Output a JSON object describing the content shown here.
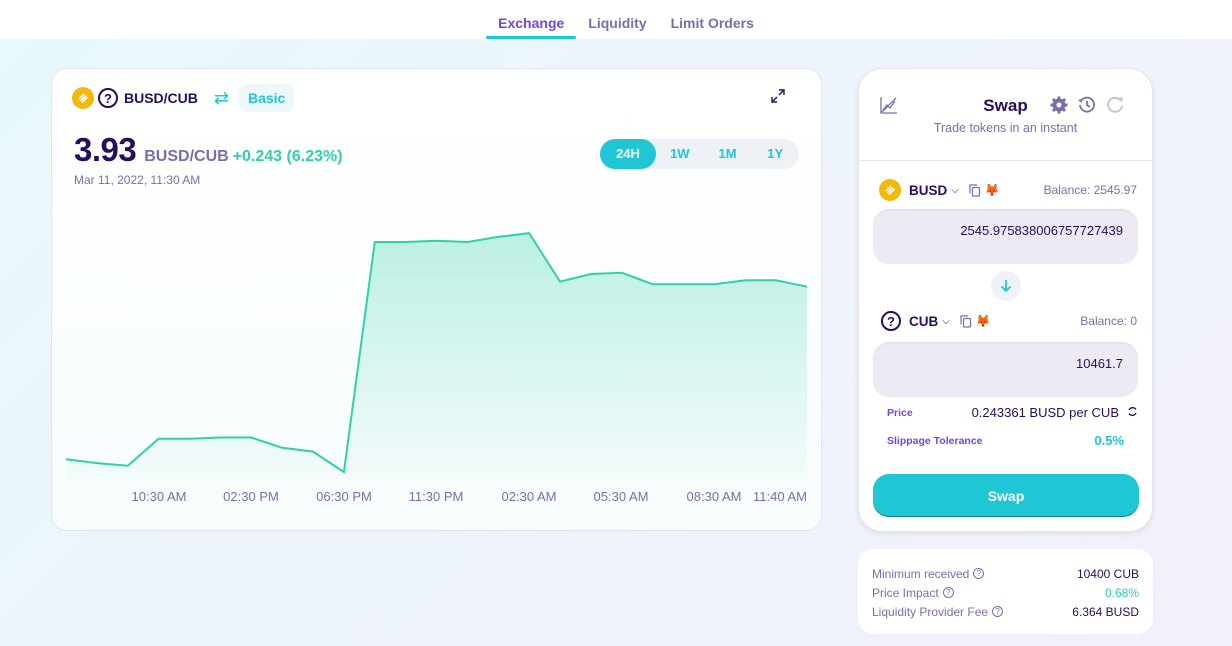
{
  "nav": {
    "tabs": [
      {
        "label": "Exchange",
        "active": true
      },
      {
        "label": "Liquidity",
        "active": false
      },
      {
        "label": "Limit Orders",
        "active": false
      }
    ]
  },
  "chart_card": {
    "pair_label": "BUSD/CUB",
    "mode_button": "Basic",
    "price": "3.93",
    "price_pair": "BUSD/CUB",
    "price_change": "+0.243 (6.23%)",
    "date": "Mar 11, 2022, 11:30 AM",
    "ranges": [
      {
        "label": "24H",
        "active": true
      },
      {
        "label": "1W",
        "active": false
      },
      {
        "label": "1M",
        "active": false
      },
      {
        "label": "1Y",
        "active": false
      }
    ],
    "icons": {
      "pair_swap": "swap-arrows-icon",
      "expand": "expand-icon"
    }
  },
  "chart_data": {
    "type": "area",
    "x_tick_labels": [
      "10:30 AM",
      "02:30 PM",
      "06:30 PM",
      "11:30 PM",
      "02:30 AM",
      "05:30 AM",
      "08:30 AM",
      "11:40 AM"
    ],
    "values": [
      3.12,
      3.09,
      3.07,
      3.28,
      3.28,
      3.29,
      3.29,
      3.21,
      3.18,
      3.02,
      4.82,
      4.82,
      4.83,
      4.82,
      4.86,
      4.89,
      4.51,
      4.57,
      4.58,
      4.49,
      4.49,
      4.49,
      4.52,
      4.52,
      4.47
    ],
    "ylim": [
      2.95,
      5.0
    ],
    "grid": false,
    "line_color": "#31d0aa"
  },
  "swap": {
    "title": "Swap",
    "subtitle": "Trade tokens in an instant",
    "from": {
      "token": "BUSD",
      "balance": "Balance: 2545.97",
      "amount": "2545.975838006757727439"
    },
    "to": {
      "token": "CUB",
      "balance": "Balance: 0",
      "amount": "10461.7"
    },
    "price_label": "Price",
    "price_value": "0.243361 BUSD per CUB",
    "slippage_label": "Slippage Tolerance",
    "slippage_value": "0.5%",
    "swap_button": "Swap"
  },
  "details": {
    "rows": [
      {
        "label": "Minimum received",
        "value": "10400 CUB"
      },
      {
        "label": "Price Impact",
        "value": "0.68%"
      },
      {
        "label": "Liquidity Provider Fee",
        "value": "6.364 BUSD"
      }
    ]
  },
  "colors": {
    "accent": "#1fc7d4",
    "primary_text": "#280d5f",
    "secondary_text": "#7a6eaa",
    "positive": "#31d0aa",
    "purple": "#7645d9"
  }
}
